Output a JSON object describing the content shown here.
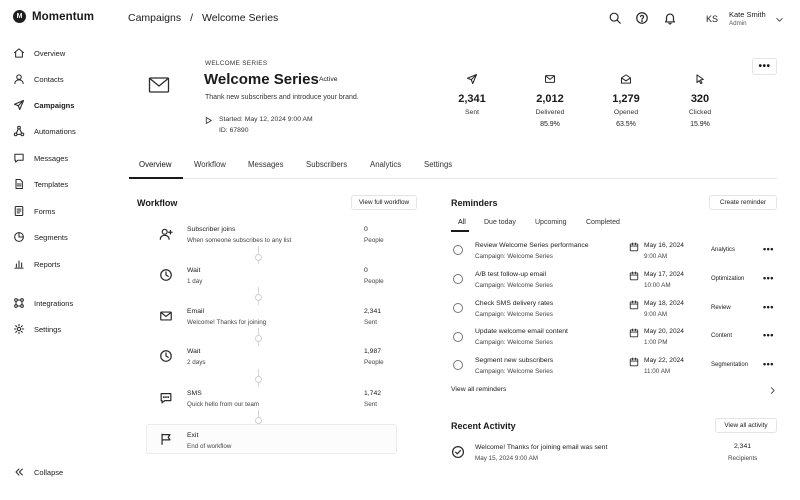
{
  "brand": {
    "logo_letter": "M",
    "name": "Momentum"
  },
  "nav": {
    "items": [
      {
        "label": "Overview"
      },
      {
        "label": "Contacts"
      },
      {
        "label": "Campaigns"
      },
      {
        "label": "Automations"
      },
      {
        "label": "Messages"
      },
      {
        "label": "Templates"
      },
      {
        "label": "Forms"
      },
      {
        "label": "Segments"
      },
      {
        "label": "Reports"
      },
      {
        "label": "Integrations"
      },
      {
        "label": "Settings"
      }
    ],
    "active": "Campaigns",
    "collapse_label": "Collapse"
  },
  "header": {
    "breadcrumb": [
      "Campaigns",
      "/",
      "Welcome Series"
    ],
    "user": {
      "initials": "KS",
      "name": "Kate Smith",
      "role": "Admin"
    }
  },
  "campaign": {
    "overline": "WELCOME SERIES",
    "title": "Welcome Series",
    "status": "Active",
    "description": "Thank new subscribers and introduce your brand.",
    "started": "Started: May 12, 2024 9:00 AM",
    "id": "ID: 67890",
    "more": "•••"
  },
  "stats": [
    {
      "icon": "send-icon",
      "value": "2,341",
      "label": "Sent",
      "pct": ""
    },
    {
      "icon": "envelope-icon",
      "value": "2,012",
      "label": "Delivered",
      "pct": "85.9%"
    },
    {
      "icon": "open-envelope-icon",
      "value": "1,279",
      "label": "Opened",
      "pct": "63.5%"
    },
    {
      "icon": "cursor-icon",
      "value": "320",
      "label": "Clicked",
      "pct": "15.9%"
    }
  ],
  "tabs": [
    {
      "label": "Overview"
    },
    {
      "label": "Workflow"
    },
    {
      "label": "Messages"
    },
    {
      "label": "Subscribers"
    },
    {
      "label": "Analytics"
    },
    {
      "label": "Settings"
    }
  ],
  "workflow": {
    "title": "Workflow",
    "view_full": "View full workflow",
    "steps": [
      {
        "icon": "user-plus-icon",
        "name": "Subscriber joins",
        "sub": "When someone subscribes to any list",
        "value": "0",
        "unit": "People"
      },
      {
        "icon": "clock-icon",
        "name": "Wait",
        "sub": "1 day",
        "value": "0",
        "unit": "People"
      },
      {
        "icon": "envelope-icon",
        "name": "Email",
        "sub": "Welcome! Thanks for joining",
        "value": "2,341",
        "unit": "Sent"
      },
      {
        "icon": "clock-icon",
        "name": "Wait",
        "sub": "2 days",
        "value": "1,987",
        "unit": "People"
      },
      {
        "icon": "chat-icon",
        "name": "SMS",
        "sub": "Quick hello from our team",
        "value": "1,742",
        "unit": "Sent"
      },
      {
        "icon": "flag-icon",
        "name": "Exit",
        "sub": "End of workflow",
        "value": "",
        "unit": ""
      }
    ]
  },
  "reminders": {
    "title": "Reminders",
    "create": "Create reminder",
    "filters": [
      "All",
      "Due today",
      "Upcoming",
      "Completed"
    ],
    "items": [
      {
        "title": "Review Welcome Series performance",
        "sub": "Campaign: Welcome Series",
        "date": "May 16, 2024",
        "time": "9:00 AM",
        "tag": "Analytics"
      },
      {
        "title": "A/B test follow-up email",
        "sub": "Campaign: Welcome Series",
        "date": "May 17, 2024",
        "time": "10:00 AM",
        "tag": "Optimization"
      },
      {
        "title": "Check SMS delivery rates",
        "sub": "Campaign: Welcome Series",
        "date": "May 18, 2024",
        "time": "9:00 AM",
        "tag": "Review"
      },
      {
        "title": "Update welcome email content",
        "sub": "Campaign: Welcome Series",
        "date": "May 20, 2024",
        "time": "1:00 PM",
        "tag": "Content"
      },
      {
        "title": "Segment new subscribers",
        "sub": "Campaign: Welcome Series",
        "date": "May 22, 2024",
        "time": "11:00 AM",
        "tag": "Segmentation"
      }
    ],
    "view_all": "View all reminders",
    "row_menu": "•••"
  },
  "activity": {
    "title": "Recent Activity",
    "view_all": "View all activity",
    "items": [
      {
        "title": "Welcome! Thanks for joining email was sent",
        "time": "May 15, 2024 9:00 AM",
        "value": "2,341",
        "unit": "Recipients"
      }
    ]
  }
}
